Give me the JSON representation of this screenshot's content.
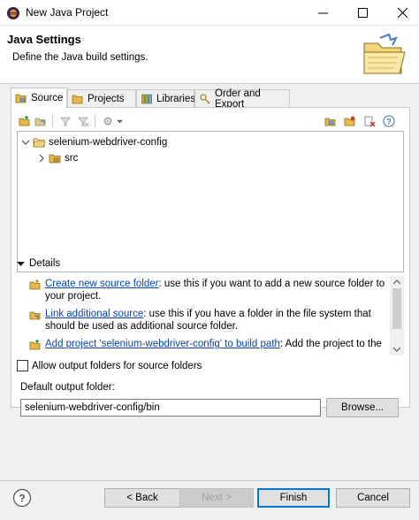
{
  "window": {
    "title": "New Java Project"
  },
  "header": {
    "title": "Java Settings",
    "description": "Define the Java build settings."
  },
  "tabs": [
    {
      "label": "Source",
      "active": true
    },
    {
      "label": "Projects",
      "active": false
    },
    {
      "label": "Libraries",
      "active": false
    },
    {
      "label": "Order and Export",
      "active": false
    }
  ],
  "tree": {
    "project": "selenium-webdriver-config",
    "folder": "src"
  },
  "details": {
    "label": "Details",
    "items": [
      {
        "link": "Create new source folder",
        "text": ": use this if you want to add a new source folder to your project."
      },
      {
        "link": "Link additional source",
        "text": ": use this if you have a folder in the file system that should be used as additional source folder."
      },
      {
        "link": "Add project 'selenium-webdriver-config' to build path",
        "text": ": Add the project to the"
      }
    ]
  },
  "options": {
    "allow_output_folders": "Allow output folders for source folders",
    "allow_output_checked": false
  },
  "output": {
    "label": "Default output folder:",
    "value": "selenium-webdriver-config/bin",
    "browse": "Browse..."
  },
  "buttons": {
    "back": "< Back",
    "next": "Next >",
    "finish": "Finish",
    "cancel": "Cancel"
  },
  "colors": {
    "link": "#0645ad",
    "accent": "#0078d7",
    "folder": "#e8b84a"
  },
  "icons": {
    "app": "eclipse-icon",
    "help": "question-icon",
    "header": "folder-wizard-icon"
  }
}
